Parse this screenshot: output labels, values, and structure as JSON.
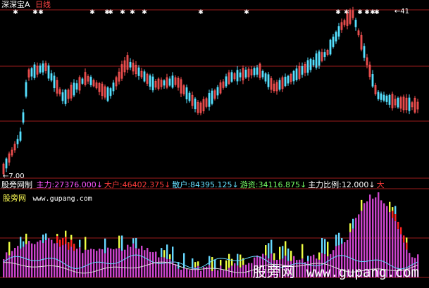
{
  "header": {
    "stock_name": "深深宝A",
    "period": "日线"
  },
  "price_panel": {
    "high_label": "41",
    "low_label": "7.00"
  },
  "indicator_row": {
    "name": "股旁网制",
    "items": [
      {
        "label": "主力",
        "value": "27376.000",
        "arrow": "↓",
        "color": "#ff55ff"
      },
      {
        "label": "大户",
        "value": "46402.375",
        "arrow": "↓",
        "color": "#ff3b3b"
      },
      {
        "label": "散户",
        "value": "84395.125",
        "arrow": "↓",
        "color": "#66e0ff"
      },
      {
        "label": "游资",
        "value": "34116.875",
        "arrow": "↓",
        "color": "#77ff66"
      },
      {
        "label": "主力比例",
        "value": "12.000",
        "arrow": "↓",
        "color": "#ffffff"
      },
      {
        "label": "大",
        "value": "",
        "arrow": "",
        "color": "#ff3b3b"
      }
    ]
  },
  "brand": {
    "name": "股旁网",
    "site": "www.gupang.com"
  },
  "watermark": {
    "name": "股旁网",
    "url": "www.gupang.com"
  },
  "colors": {
    "up": "#ff5555",
    "down": "#55e0ff",
    "grid": "#9b1b1b",
    "main_force": "#cc44cc",
    "big_holder": "#ff2222",
    "retail": "#66d8ff",
    "hot_money": "#eeff44"
  }
}
